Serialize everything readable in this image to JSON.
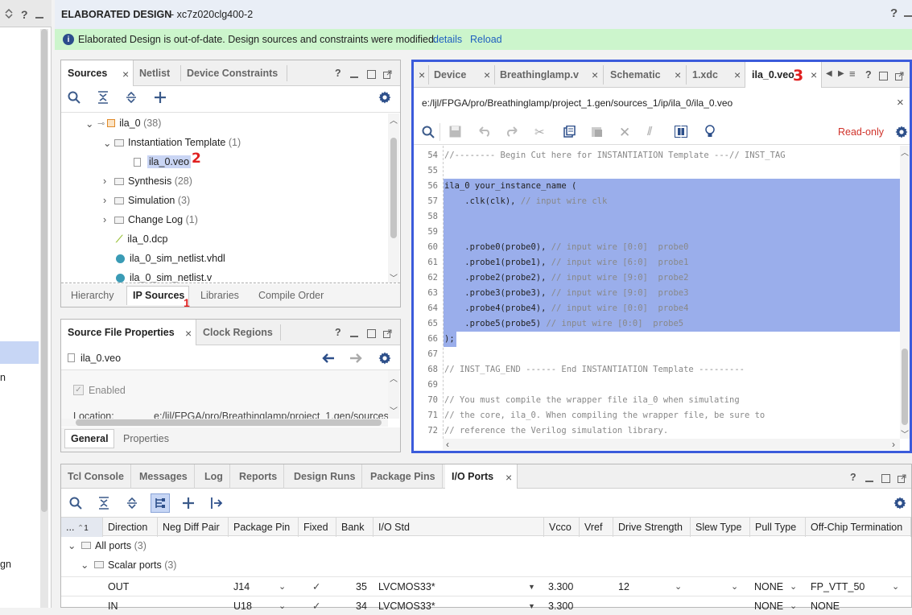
{
  "left_strip": {
    "labels": [
      "n",
      "gn"
    ]
  },
  "header": {
    "title": "ELABORATED DESIGN",
    "part": " - xc7z020clg400-2",
    "help": "?"
  },
  "banner": {
    "message": "Elaborated Design is out-of-date. Design sources and constraints were modified.",
    "details": "details",
    "reload": "Reload"
  },
  "sources": {
    "tabs": [
      "Sources",
      "Netlist",
      "Device Constraints"
    ],
    "tree": [
      {
        "label": "ila_0",
        "count": "(38)"
      },
      {
        "label": "Instantiation Template",
        "count": "(1)"
      },
      {
        "label": "ila_0.veo",
        "count": ""
      },
      {
        "label": "Synthesis",
        "count": "(28)"
      },
      {
        "label": "Simulation",
        "count": "(3)"
      },
      {
        "label": "Change Log",
        "count": "(1)"
      },
      {
        "label": "ila_0.dcp",
        "count": ""
      },
      {
        "label": "ila_0_sim_netlist.vhdl",
        "count": ""
      },
      {
        "label": "ila_0_sim_netlist.v",
        "count": ""
      }
    ],
    "bottom_tabs": [
      "Hierarchy",
      "IP Sources",
      "Libraries",
      "Compile Order"
    ]
  },
  "annotations": {
    "a1": "1",
    "a2": "2",
    "a3": "3"
  },
  "sfp": {
    "tabs": [
      "Source File Properties",
      "Clock Regions"
    ],
    "file": "ila_0.veo",
    "enabled": "Enabled",
    "location_label": "Location:",
    "location_value": "e:/ljl/FPGA/pro/Breathinglamp/project_1.gen/sources",
    "bottom_tabs": [
      "General",
      "Properties"
    ]
  },
  "editor": {
    "tabs": [
      "Device",
      "Breathinglamp.v",
      "Schematic",
      "1.xdc",
      "ila_0.veo"
    ],
    "path": "e:/ljl/FPGA/pro/Breathinglamp/project_1.gen/sources_1/ip/ila_0/ila_0.veo",
    "readonly": "Read-only",
    "lines": [
      {
        "n": "54",
        "code": "",
        "comment": "//-------- Begin Cut here for INSTANTIATION Template ---// INST_TAG",
        "sel": false
      },
      {
        "n": "55",
        "code": "",
        "comment": "",
        "sel": false
      },
      {
        "n": "56",
        "code": "ila_0 your_instance_name (",
        "comment": "",
        "sel": true
      },
      {
        "n": "57",
        "code": "    .clk(clk), ",
        "comment": "// input wire clk",
        "sel": true
      },
      {
        "n": "58",
        "code": "",
        "comment": "",
        "sel": true
      },
      {
        "n": "59",
        "code": "",
        "comment": "",
        "sel": true
      },
      {
        "n": "60",
        "code": "    .probe0(probe0), ",
        "comment": "// input wire [0:0]  probe0",
        "sel": true
      },
      {
        "n": "61",
        "code": "    .probe1(probe1), ",
        "comment": "// input wire [6:0]  probe1",
        "sel": true
      },
      {
        "n": "62",
        "code": "    .probe2(probe2), ",
        "comment": "// input wire [9:0]  probe2",
        "sel": true
      },
      {
        "n": "63",
        "code": "    .probe3(probe3), ",
        "comment": "// input wire [9:0]  probe3",
        "sel": true
      },
      {
        "n": "64",
        "code": "    .probe4(probe4), ",
        "comment": "// input wire [0:0]  probe4",
        "sel": true
      },
      {
        "n": "65",
        "code": "    .probe5(probe5) ",
        "comment": "// input wire [0:0]  probe5",
        "sel": true
      },
      {
        "n": "66",
        "code": ");",
        "comment": "",
        "sel": "partial"
      },
      {
        "n": "67",
        "code": "",
        "comment": "",
        "sel": false
      },
      {
        "n": "68",
        "code": "",
        "comment": "// INST_TAG_END ------ End INSTANTIATION Template ---------",
        "sel": false
      },
      {
        "n": "69",
        "code": "",
        "comment": "",
        "sel": false
      },
      {
        "n": "70",
        "code": "",
        "comment": "// You must compile the wrapper file ila_0 when simulating",
        "sel": false
      },
      {
        "n": "71",
        "code": "",
        "comment": "// the core, ila_0. When compiling the wrapper file, be sure to",
        "sel": false
      },
      {
        "n": "72",
        "code": "",
        "comment": "// reference the Verilog simulation library.",
        "sel": false
      }
    ]
  },
  "bottom": {
    "tabs": [
      "Tcl Console",
      "Messages",
      "Log",
      "Reports",
      "Design Runs",
      "Package Pins",
      "I/O Ports"
    ],
    "columns": [
      "...",
      "Direction",
      "Neg Diff Pair",
      "Package Pin",
      "Fixed",
      "Bank",
      "I/O Std",
      "Vcco",
      "Vref",
      "Drive Strength",
      "Slew Type",
      "Pull Type",
      "Off-Chip Termination"
    ],
    "sort_indicator": "1",
    "groups": [
      {
        "label": "All ports",
        "count": "(3)"
      },
      {
        "label": "Scalar ports",
        "count": "(3)"
      }
    ],
    "rows": [
      {
        "name": "OUT",
        "pin": "J14",
        "fixed": "✓",
        "bank": "35",
        "iostd": "LVCMOS33*",
        "vcco": "3.300",
        "drive": "12",
        "pull": "NONE",
        "term": "FP_VTT_50"
      },
      {
        "name": "IN",
        "pin": "U18",
        "fixed": "✓",
        "bank": "34",
        "iostd": "LVCMOS33*",
        "vcco": "3.300",
        "drive": "",
        "pull": "NONE",
        "term": "NONE"
      }
    ]
  },
  "colors": {
    "accent": "#3b5bdb",
    "selection": "#9aaeeb",
    "banner": "#ccf5cc",
    "readonly": "#d0332b",
    "annotation": "#e02020"
  }
}
